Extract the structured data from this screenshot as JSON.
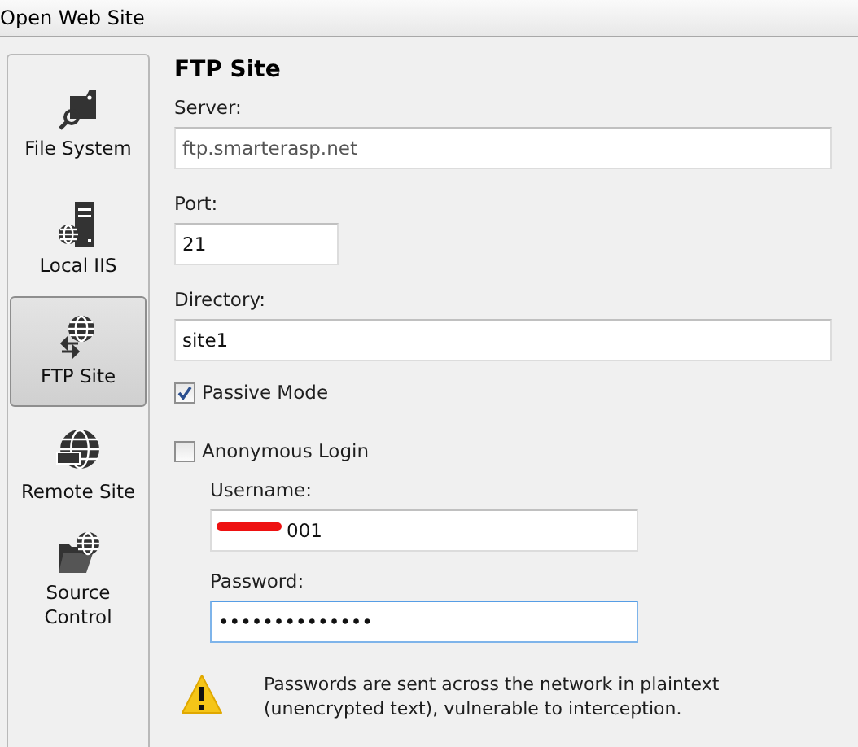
{
  "window": {
    "title": "Open Web Site"
  },
  "sidebar": {
    "items": [
      {
        "label": "File System",
        "kind": "folder",
        "selected": false
      },
      {
        "label": "Local IIS",
        "kind": "server",
        "selected": false
      },
      {
        "label": "FTP Site",
        "kind": "ftp",
        "selected": true
      },
      {
        "label": "Remote Site",
        "kind": "http",
        "selected": false
      },
      {
        "label": "Source Control",
        "kind": "source",
        "selected": false
      }
    ]
  },
  "panel": {
    "heading": "FTP Site",
    "server": {
      "label": "Server:",
      "value": "ftp.smarterasp.net"
    },
    "port": {
      "label": "Port:",
      "value": "21"
    },
    "directory": {
      "label": "Directory:",
      "value": "site1"
    },
    "passive_mode": {
      "label": "Passive Mode",
      "checked": true
    },
    "anonymous_login": {
      "label": "Anonymous Login",
      "checked": false
    },
    "username": {
      "label": "Username:",
      "value": "001",
      "redacted": true
    },
    "password": {
      "label": "Password:",
      "value": "••••••••••••••",
      "focused": true
    },
    "warning": "Passwords are sent across the network in plaintext (unencrypted text), vulnerable to interception."
  }
}
